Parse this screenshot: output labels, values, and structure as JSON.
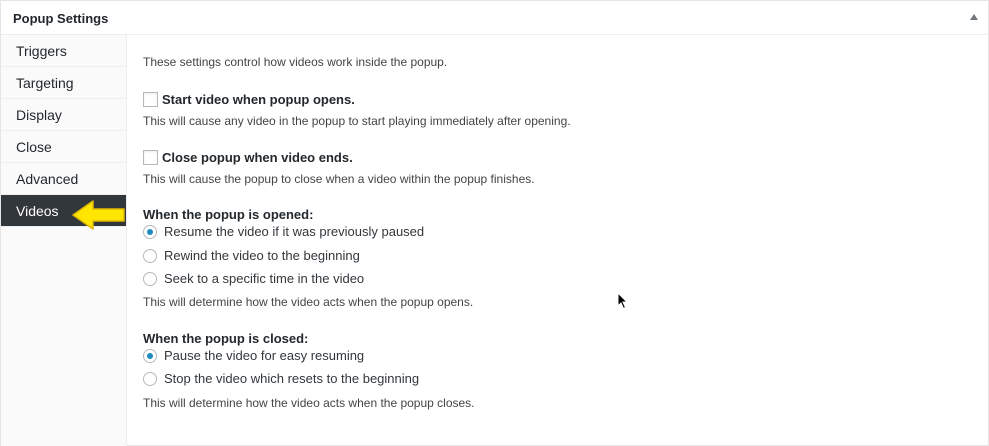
{
  "panel": {
    "title": "Popup Settings"
  },
  "tabs": [
    {
      "label": "Triggers"
    },
    {
      "label": "Targeting"
    },
    {
      "label": "Display"
    },
    {
      "label": "Close"
    },
    {
      "label": "Advanced"
    },
    {
      "label": "Videos",
      "active": true
    }
  ],
  "videos": {
    "intro": "These settings control how videos work inside the popup.",
    "start_video": {
      "label": "Start video when popup opens.",
      "checked": false,
      "description": "This will cause any video in the popup to start playing immediately after opening."
    },
    "close_popup": {
      "label": "Close popup when video ends.",
      "checked": false,
      "description": "This will cause the popup to close when a video within the popup finishes."
    },
    "on_open": {
      "title": "When the popup is opened:",
      "options": [
        {
          "label": "Resume the video if it was previously paused",
          "checked": true
        },
        {
          "label": "Rewind the video to the beginning",
          "checked": false
        },
        {
          "label": "Seek to a specific time in the video",
          "checked": false
        }
      ],
      "description": "This will determine how the video acts when the popup opens."
    },
    "on_close": {
      "title": "When the popup is closed:",
      "options": [
        {
          "label": "Pause the video for easy resuming",
          "checked": true
        },
        {
          "label": "Stop the video which resets to the beginning",
          "checked": false
        }
      ],
      "description": "This will determine how the video acts when the popup closes."
    }
  },
  "colors": {
    "active_tab_bg": "#32373c",
    "radio_accent": "#1e8cbe",
    "arrow_fill": "#ffe600"
  }
}
